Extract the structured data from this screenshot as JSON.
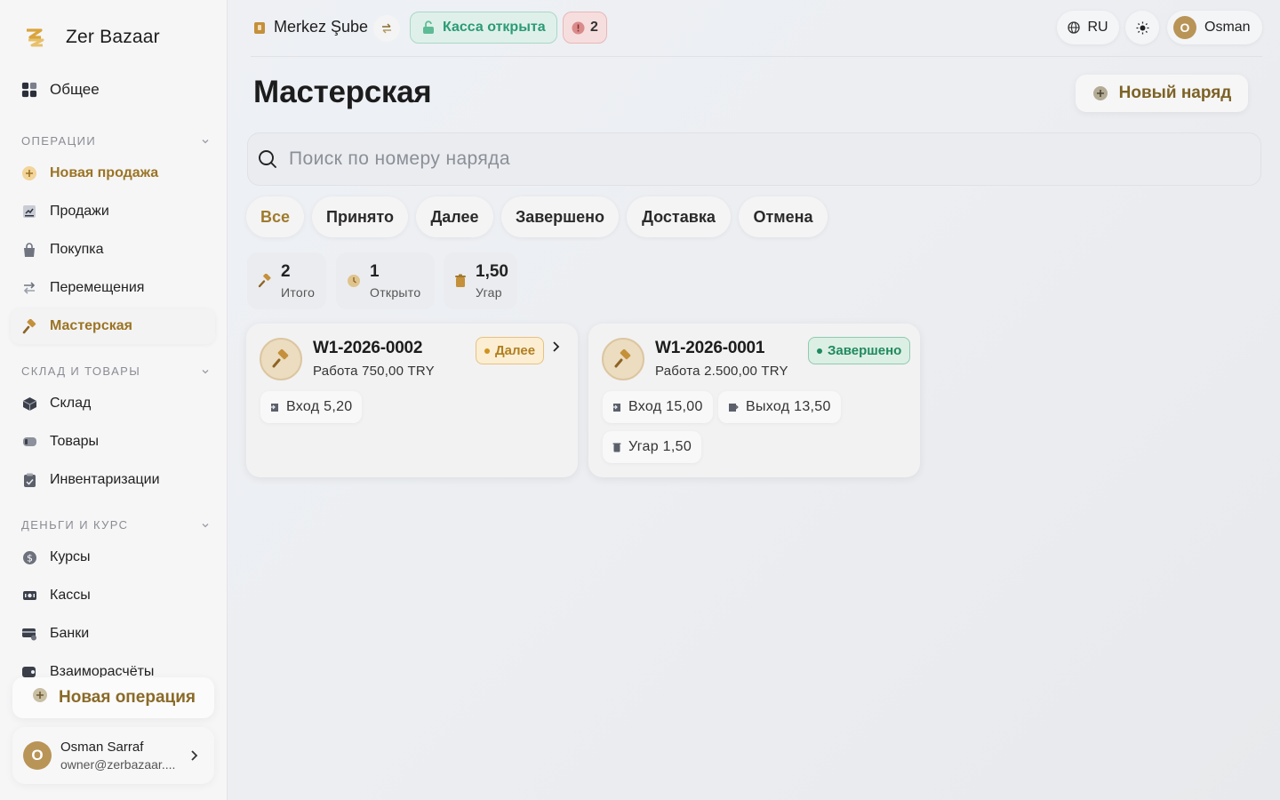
{
  "app": {
    "name": "Zer Bazaar"
  },
  "sidebar": {
    "general": "Общее",
    "sections": {
      "operations": "ОПЕРАЦИИ",
      "warehouse": "СКЛАД И ТОВАРЫ",
      "money": "ДЕНЬГИ И КУРС"
    },
    "operations": [
      {
        "label": "Новая продажа",
        "icon": "plus-circle-icon"
      },
      {
        "label": "Продажи",
        "icon": "receipt-icon"
      },
      {
        "label": "Покупка",
        "icon": "shopping-bag-icon"
      },
      {
        "label": "Перемещения",
        "icon": "transfer-icon"
      },
      {
        "label": "Мастерская",
        "icon": "hammer-icon",
        "active": true
      }
    ],
    "warehouse": [
      {
        "label": "Склад",
        "icon": "box-icon"
      },
      {
        "label": "Товары",
        "icon": "tag-icon"
      },
      {
        "label": "Инвентаризации",
        "icon": "clipboard-icon"
      }
    ],
    "money": [
      {
        "label": "Курсы",
        "icon": "dollar-coin-icon"
      },
      {
        "label": "Кассы",
        "icon": "cash-register-icon"
      },
      {
        "label": "Банки",
        "icon": "bank-card-icon"
      },
      {
        "label": "Взаиморасчёты",
        "icon": "wallet-icon"
      }
    ],
    "new_operation": "Новая операция",
    "user": {
      "initial": "O",
      "name": "Osman Sarraf",
      "email": "owner@zerbazaar...."
    }
  },
  "topbar": {
    "branch": "Merkez Şube",
    "kassa_status": "Касса открыта",
    "alerts_count": "2",
    "language": "RU",
    "user_initial": "O",
    "user_name": "Osman"
  },
  "page": {
    "title": "Мастерская",
    "new_order_label": "Новый наряд",
    "search_placeholder": "Поиск по номеру наряда",
    "filters": [
      "Все",
      "Принято",
      "Далее",
      "Завершено",
      "Доставка",
      "Отмена"
    ],
    "active_filter": "Все",
    "stats": [
      {
        "value": "2",
        "label": "Итого",
        "icon": "hammer-icon"
      },
      {
        "value": "1",
        "label": "Открыто",
        "icon": "clock-icon"
      },
      {
        "value": "1,50",
        "label": "Угар",
        "icon": "trash-icon"
      }
    ]
  },
  "orders": [
    {
      "id": "W1-2026-0002",
      "work": "Работа 750,00 TRY",
      "status": "Далее",
      "chips": [
        "Вход 5,20"
      ]
    },
    {
      "id": "W1-2026-0001",
      "work": "Работа 2.500,00 TRY",
      "status": "Завершено",
      "chips": [
        "Вход 15,00",
        "Выход 13,50",
        "Угар 1,50"
      ]
    }
  ],
  "colors": {
    "accent": "#9b7424",
    "kassa_green": "#2b9b74",
    "status_next": "#b27f1f",
    "status_done": "#1f8a5d"
  }
}
